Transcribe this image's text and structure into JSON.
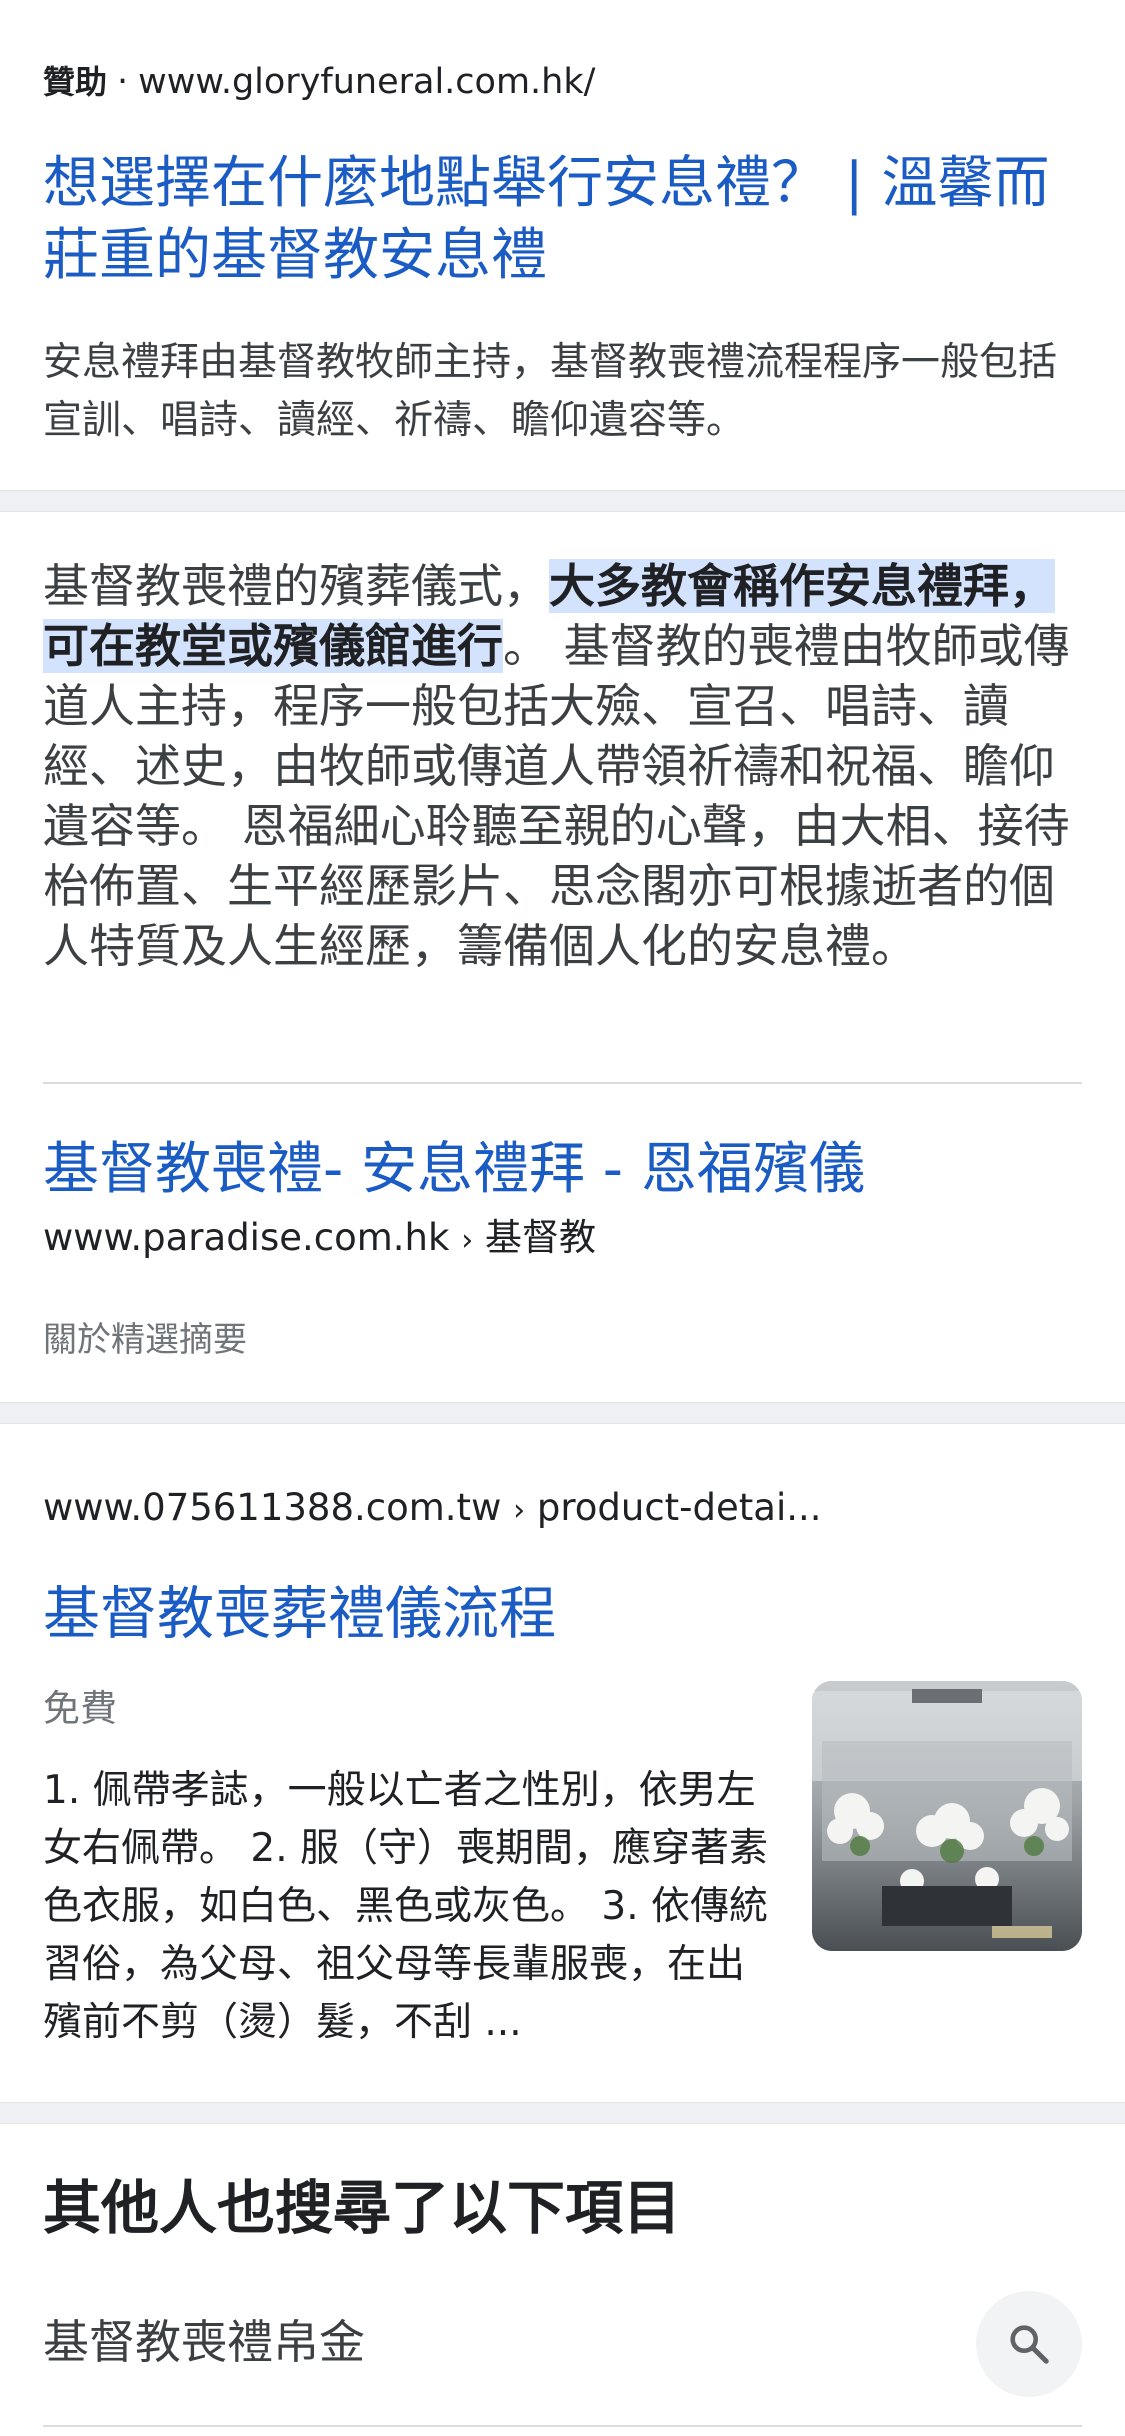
{
  "ad": {
    "badge": "贊助",
    "dot": "·",
    "url": "www.gloryfuneral.com.hk/",
    "title": "想選擇在什麼地點舉行安息禮？ | 溫馨而莊重的基督教安息禮",
    "description": "安息禮拜由基督教牧師主持，基督教喪禮流程程序一般包括宣訓、唱詩、讀經、祈禱、瞻仰遺容等。"
  },
  "snippet": {
    "text_before": "基督教喪禮的殯葬儀式，",
    "text_highlight": "大多教會稱作安息禮拜，可在教堂或殯儀館進行",
    "text_after": "。 基督教的喪禮由牧師或傳道人主持，程序一般包括大殮、宣召、唱詩、讀經、述史，由牧師或傳道人帶領祈禱和祝福、瞻仰遺容等。 恩福細心聆聽至親的心聲，由大相、接待枱佈置、生平經歷影片、思念閣亦可根據逝者的個人特質及人生經歷，籌備個人化的安息禮。",
    "link_title": "基督教喪禮- 安息禮拜 - 恩福殯儀",
    "url_domain": "www.paradise.com.hk",
    "url_sep": "›",
    "url_path": "基督教",
    "about": "關於精選摘要"
  },
  "result3": {
    "url_domain": "www.075611388.com.tw",
    "url_sep": "›",
    "url_path": "product-detai...",
    "title": "基督教喪葬禮儀流程",
    "price": "免費",
    "description": "1. 佩帶孝誌，一般以亡者之性別，依男左女右佩帶。 2. 服（守）喪期間，應穿著素色衣服，如白色、黑色或灰色。 3. 依傳統習俗，為父母、祖父母等長輩服喪，在出殯前不剪（燙）髮，不刮 ..."
  },
  "people_also_search": {
    "heading": "其他人也搜尋了以下項目",
    "items": [
      {
        "label": "基督教喪禮帛金",
        "icon": "search-icon"
      }
    ]
  },
  "colors": {
    "link": "#1a5bc4",
    "highlight": "#d3e3fd",
    "separator": "#eef0f3"
  }
}
